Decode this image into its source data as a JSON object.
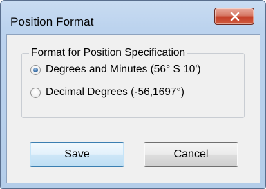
{
  "window": {
    "title": "Position Format",
    "close_icon": "close-x-icon"
  },
  "group": {
    "title": "Format for Position Specification",
    "options": [
      {
        "label": "Degrees and Minutes (56° S 10')",
        "checked": true
      },
      {
        "label": "Decimal Degrees (-56,1697°)",
        "checked": false
      }
    ]
  },
  "buttons": {
    "save_label": "Save",
    "cancel_label": "Cancel"
  },
  "colors": {
    "title_bar": "#bcd3ee",
    "close_button": "#c4412a",
    "client_background": "#f0f0f0",
    "default_button_border": "#3c7fb1"
  }
}
